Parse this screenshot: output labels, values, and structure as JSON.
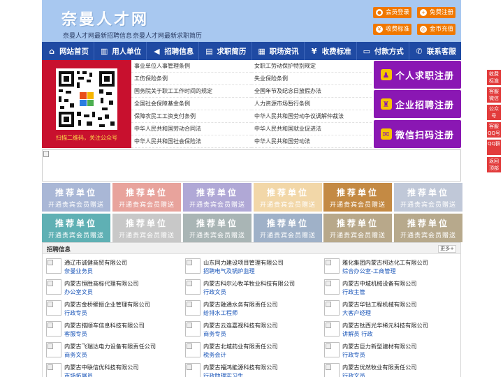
{
  "header": {
    "site_title": "奈曼人才网",
    "slogan_jobs": "奈曼人才网最新招聘信息",
    "slogan_resumes": "奈曼人才网最新求职简历",
    "buttons": [
      {
        "label": "会员登录",
        "icon": "user-icon"
      },
      {
        "label": "免费注册",
        "icon": "person-add-icon"
      },
      {
        "label": "收费标准",
        "icon": "yen-icon"
      },
      {
        "label": "金币充值",
        "icon": "coin-icon"
      }
    ]
  },
  "nav": [
    {
      "label": "网站首页",
      "icon": "home-icon"
    },
    {
      "label": "用人单位",
      "icon": "building-icon"
    },
    {
      "label": "招聘信息",
      "icon": "megaphone-icon"
    },
    {
      "label": "求职简历",
      "icon": "document-icon"
    },
    {
      "label": "职场资讯",
      "icon": "newspaper-icon"
    },
    {
      "label": "收费标准",
      "icon": "yen-icon"
    },
    {
      "label": "付款方式",
      "icon": "wallet-icon"
    },
    {
      "label": "联系客服",
      "icon": "phone-icon"
    }
  ],
  "qr": {
    "caption": "扫描二维码，关注公众号"
  },
  "regulations": {
    "left": [
      "事业单位人事管理条例",
      "工伤保险条例",
      "国务院关于职工工作时间的规定",
      "全国社会保障基金条例",
      "保障农民工工资支付条例",
      "中华人民共和国劳动合同法",
      "中华人民共和国社会保险法"
    ],
    "right": [
      "女职工劳动保护特别规定",
      "失业保险条例",
      "全国年节及纪念日放假办法",
      "人力资源市场暂行条例",
      "中华人民共和国劳动争议调解仲裁法",
      "中华人民共和国就业促进法",
      "中华人民共和国劳动法"
    ]
  },
  "register": [
    {
      "label": "个人求职注册",
      "icon": "person-icon"
    },
    {
      "label": "企业招聘注册",
      "icon": "enterprise-icon"
    },
    {
      "label": "微信扫码注册",
      "icon": "wechat-icon"
    }
  ],
  "sidefloat": [
    "收费标准",
    "客服微信",
    "公众号",
    "客服QQ号",
    "QQ群",
    "返回顶部"
  ],
  "ads": {
    "title": "推荐单位",
    "subtitle": "开通贵宾会员赠送",
    "colors": [
      "#a9b7d6",
      "#e8a39c",
      "#b0a8d6",
      "#f2d7a8",
      "#c48a44",
      "#c0c8d8",
      "#5fb0b4",
      "#c8c8c8",
      "#a9b5b5",
      "#9fb1c8",
      "#b8a88a",
      "#b7a98c"
    ]
  },
  "jobs": {
    "title": "招聘信息",
    "more": "更多+",
    "columns": [
      [
        {
          "company": "通辽市诚健商贸有限公司",
          "position": "奈曼业务员"
        },
        {
          "company": "内蒙古恒胜商标代理有限公司",
          "position": "办公室文员"
        },
        {
          "company": "内蒙古金桥壁振企业管理有限公司",
          "position": "行政专员"
        },
        {
          "company": "内蒙古搭顺车信息科技有限公司",
          "position": "客服专员"
        },
        {
          "company": "内蒙古飞瑞达电力设备有限责任公司",
          "position": "商务文员"
        },
        {
          "company": "内蒙古中联信优科技有限公司",
          "position": "市场拓展员"
        }
      ],
      [
        {
          "company": "山东同力建设项目管理有限公司",
          "position": "招聘电气及锅炉监理"
        },
        {
          "company": "内蒙古科尔沁牧羊牧业科技有限公司",
          "position": "行政文员"
        },
        {
          "company": "内蒙古融通水务有限责任公司",
          "position": "给排水工程师"
        },
        {
          "company": "内蒙古云连嘉视科技有限公司",
          "position": "商务专员"
        },
        {
          "company": "内蒙古北城药业有限责任公司",
          "position": "税务会计"
        },
        {
          "company": "内蒙古福鸿能源科技有限公司",
          "position": "行政助理实习生"
        }
      ],
      [
        {
          "company": "雅化集团内蒙古柯达化工有限公司",
          "position": "综合办公室-工商管理"
        },
        {
          "company": "内蒙古中城机械设备有限公司",
          "position": "行政主管"
        },
        {
          "company": "内蒙古华钻工程机械有限公司",
          "position": "大客户经理"
        },
        {
          "company": "内蒙古钛西光华稀元科技有限公司",
          "position": "讲解员 行政"
        },
        {
          "company": "内蒙古巨力新型建材有限公司",
          "position": "行政专员"
        },
        {
          "company": "内蒙古优然牧业有限责任公司",
          "position": "行政文员"
        }
      ]
    ]
  }
}
